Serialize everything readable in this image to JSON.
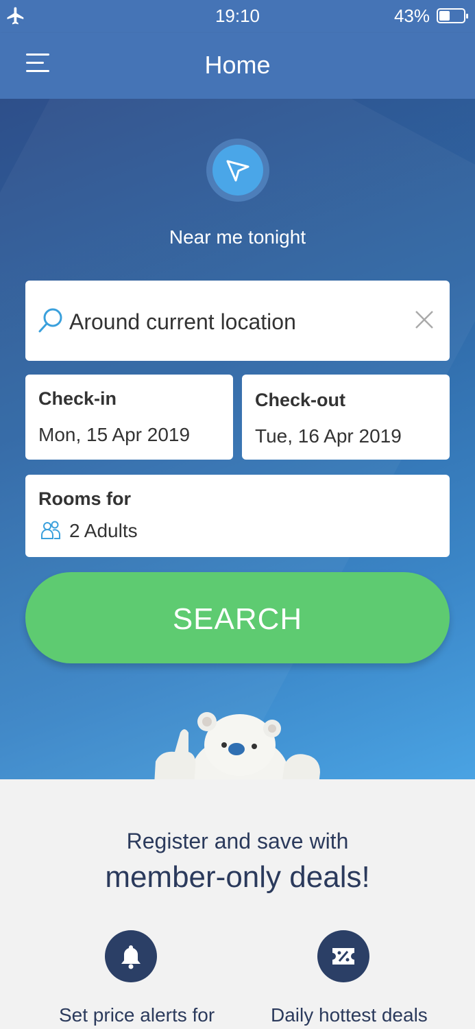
{
  "status_bar": {
    "time": "19:10",
    "battery_percent": "43%",
    "battery_level": 0.43
  },
  "header": {
    "title": "Home"
  },
  "near_me": {
    "label": "Near me tonight"
  },
  "search": {
    "value": "Around current location"
  },
  "checkin": {
    "label": "Check-in",
    "date": "Mon, 15 Apr 2019"
  },
  "checkout": {
    "label": "Check-out",
    "date": "Tue, 16 Apr 2019"
  },
  "rooms": {
    "label": "Rooms for",
    "guests": "2 Adults"
  },
  "search_button": {
    "label": "SEARCH"
  },
  "promo": {
    "line1": "Register and save with",
    "line2": "member-only deals!",
    "features": [
      {
        "label": "Set price alerts for",
        "icon": "bell-icon"
      },
      {
        "label": "Daily hottest deals",
        "icon": "discount-ticket-icon"
      }
    ]
  },
  "colors": {
    "header": "#4574b6",
    "search_button": "#5ecb71",
    "accent": "#2b3f66"
  }
}
